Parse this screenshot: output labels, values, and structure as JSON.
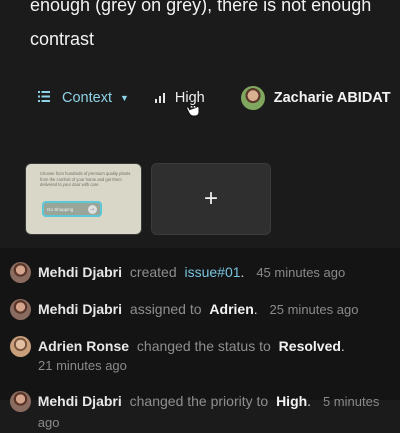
{
  "issue": {
    "title": "enough (grey on grey), there is not enough contrast"
  },
  "meta": {
    "context_label": "Context",
    "priority_label": "High",
    "assignee_name": "Zacharie ABIDAT"
  },
  "attachments": {
    "thumbnail_text": "Choose from hundreds of premium quality plants from the comfort of your home and get them delivered to your door with care.",
    "thumbnail_button_label": "Go Shopping",
    "add_label": "+"
  },
  "activity": [
    {
      "actor": "Mehdi Djabri",
      "action": "created",
      "target": "issue#01",
      "target_end": ".",
      "time": "45 minutes ago"
    },
    {
      "actor": "Mehdi Djabri",
      "action": "assigned to",
      "target": "Adrien",
      "target_end": ".",
      "time": "25 minutes ago"
    },
    {
      "actor": "Adrien Ronse",
      "action": "changed the status to",
      "target": "Resolved",
      "target_end": ".",
      "time": "21 minutes ago"
    },
    {
      "actor": "Mehdi Djabri",
      "action": "changed the priority to",
      "target": "High",
      "target_end": ".",
      "time": "5 minutes ago"
    }
  ],
  "colors": {
    "accent": "#8fd3e8",
    "link": "#79c3df",
    "background": "#1b1b1b",
    "activity_background": "#141414"
  }
}
